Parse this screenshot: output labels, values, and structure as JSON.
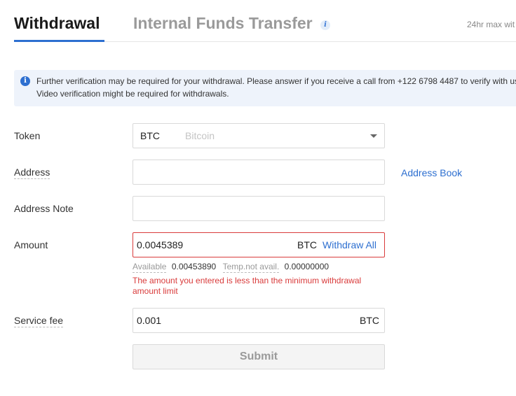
{
  "tabs": {
    "withdrawal": "Withdrawal",
    "internal_transfer": "Internal Funds Transfer",
    "info_icon": "i"
  },
  "limit_text": "24hr max wit",
  "notice": {
    "icon": "info-circle-icon",
    "line1": "Further verification may be required for your withdrawal. Please answer if you receive a call from +122 6798 4487 to verify with us.",
    "line2": "Video verification might be required for withdrawals."
  },
  "form": {
    "token": {
      "label": "Token",
      "symbol": "BTC",
      "name": "Bitcoin"
    },
    "address": {
      "label": "Address",
      "value": "",
      "address_book": "Address Book"
    },
    "address_note": {
      "label": "Address Note",
      "value": ""
    },
    "amount": {
      "label": "Amount",
      "value": "0.0045389",
      "unit": "BTC",
      "withdraw_all": "Withdraw All",
      "available_label": "Available",
      "available_value": "0.00453890",
      "temp_label": "Temp.not avail.",
      "temp_value": "0.00000000",
      "error_line1": "The amount you entered is less than the minimum withdrawal",
      "error_line2": "amount limit"
    },
    "service_fee": {
      "label": "Service fee",
      "value": "0.001",
      "unit": "BTC"
    },
    "submit": "Submit"
  },
  "colors": {
    "accent": "#2d6fd0",
    "error": "#d93b3b",
    "notice_bg": "#eef3fb"
  }
}
